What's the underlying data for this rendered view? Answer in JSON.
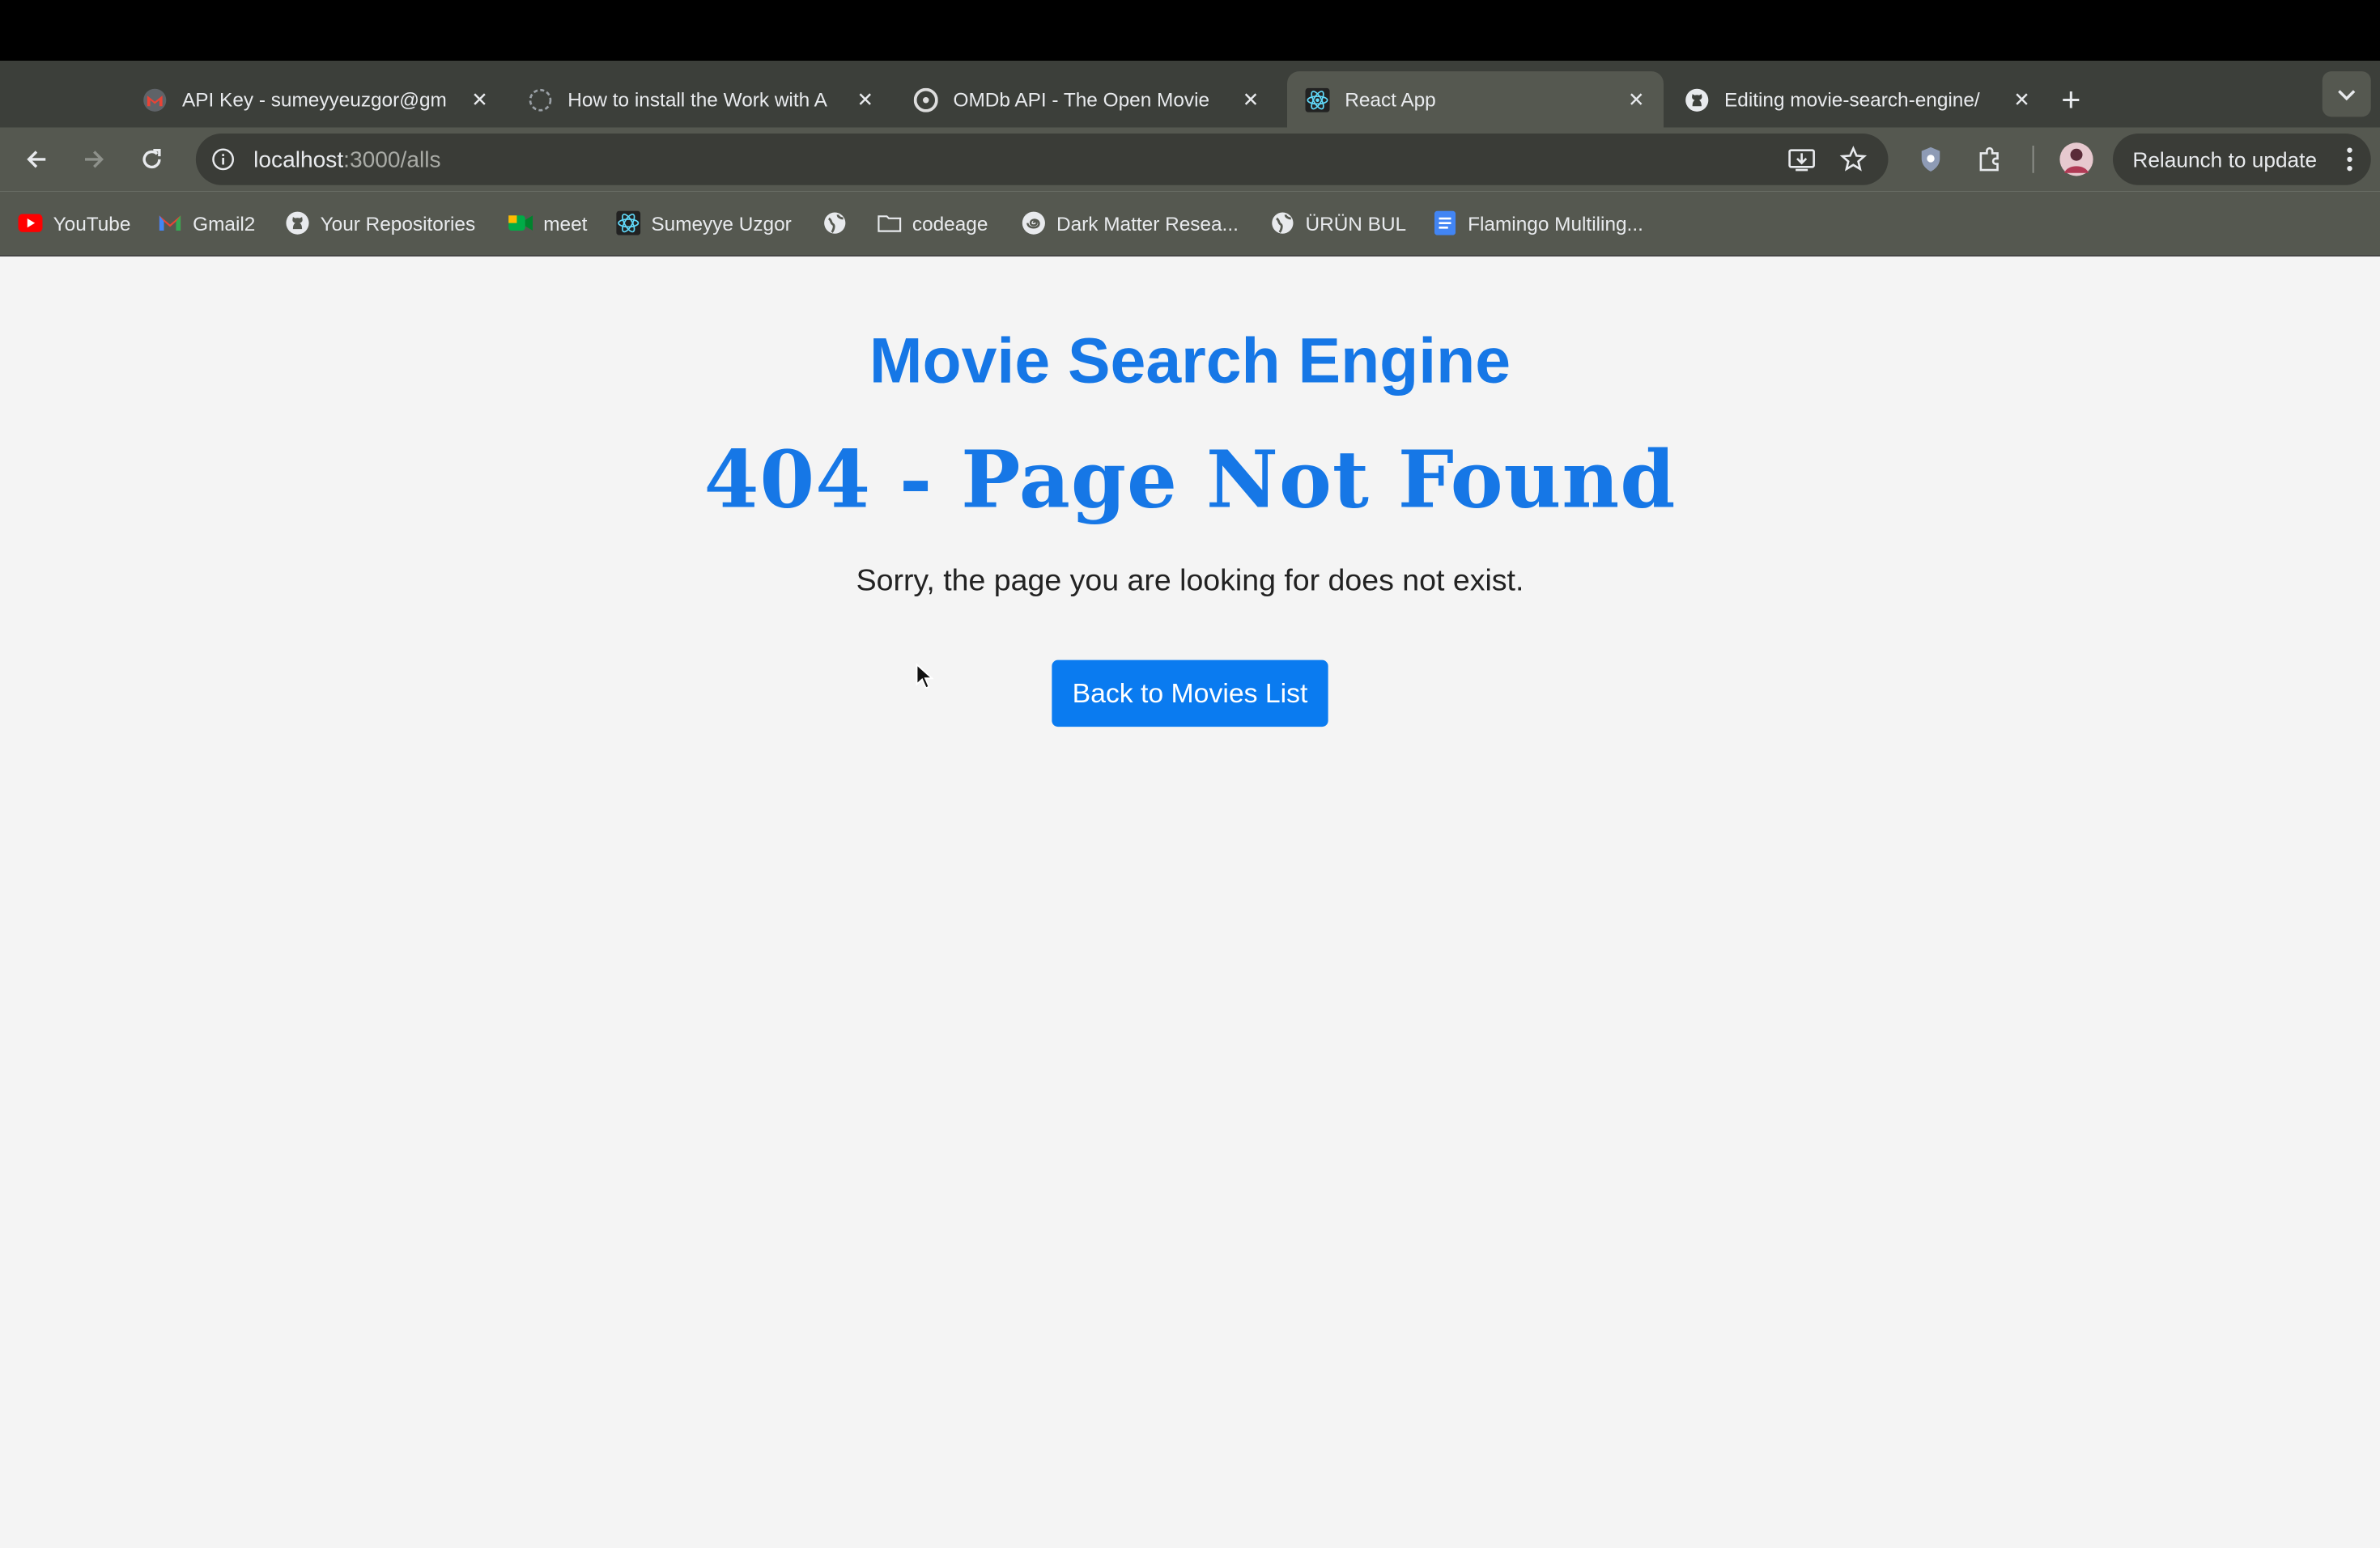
{
  "browser": {
    "tabs": [
      {
        "title": "API Key - sumeyyeuzgor@gm",
        "icon": "gmail-icon"
      },
      {
        "title": "How to install the Work with A",
        "icon": "loading-icon"
      },
      {
        "title": "OMDb API - The Open Movie",
        "icon": "omdb-icon"
      },
      {
        "title": "React App",
        "icon": "react-icon",
        "active": true
      },
      {
        "title": "Editing movie-search-engine/",
        "icon": "github-icon"
      }
    ],
    "new_tab": "+",
    "address": {
      "host": "localhost",
      "path": ":3000/alls"
    },
    "relaunch_label": "Relaunch to update",
    "bookmarks": [
      {
        "label": "YouTube",
        "icon": "youtube-icon"
      },
      {
        "label": "Gmail2",
        "icon": "gmail-icon"
      },
      {
        "label": "Your Repositories",
        "icon": "github-icon"
      },
      {
        "label": "meet",
        "icon": "meet-icon"
      },
      {
        "label": "Sumeyye Uzgor",
        "icon": "react-icon"
      },
      {
        "label": "",
        "icon": "globe-icon"
      },
      {
        "label": "codeage",
        "icon": "folder-icon"
      },
      {
        "label": "Dark Matter Resea...",
        "icon": "spiral-icon"
      },
      {
        "label": "ÜRÜN BUL",
        "icon": "globe-icon"
      },
      {
        "label": "Flamingo Multiling...",
        "icon": "docs-icon"
      }
    ]
  },
  "page": {
    "app_title": "Movie Search Engine",
    "not_found_title": "404 - Page Not Found",
    "message": "Sorry, the page you are looking for does not exist.",
    "back_button": "Back to Movies List"
  },
  "colors": {
    "accent": "#1677e6",
    "button": "#0a7bf0",
    "background": "#f4f4f4"
  }
}
